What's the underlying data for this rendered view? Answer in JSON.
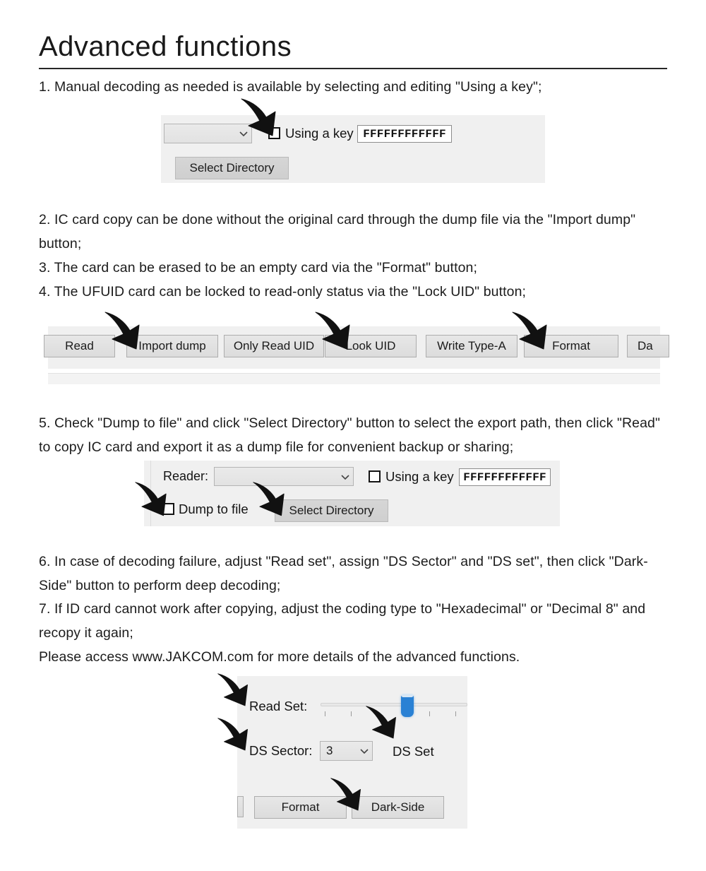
{
  "doc": {
    "title": "Advanced functions",
    "paragraphs": [
      {
        "id": "p1",
        "text": "1. Manual decoding as needed is available by selecting and editing \"Using a key\";"
      },
      {
        "id": "p2",
        "text": "2. IC card copy can be done without the original card through the dump file via the \"Import dump\" button;"
      },
      {
        "id": "p3",
        "text": "3. The card can be erased to be an empty card via the \"Format\" button;"
      },
      {
        "id": "p4",
        "text": "4. The UFUID card can be locked to read-only status via the \"Lock UID\" button;"
      },
      {
        "id": "p5",
        "text": "5. Check \"Dump to file\" and click \"Select Directory\" button to select the export path, then click \"Read\" to copy IC card and export it as a dump file for convenient backup or sharing;"
      },
      {
        "id": "p6",
        "text": "6. In case of decoding failure, adjust \"Read set\", assign \"DS Sector\" and \"DS set\", then click \"Dark-Side\" button to perform deep decoding;"
      },
      {
        "id": "p7",
        "text": "7. If ID card cannot work after copying, adjust the coding type to \"Hexadecimal\" or \"Decimal 8\" and recopy it again;"
      },
      {
        "id": "p8",
        "text": "Please access www.JAKCOM.com for more details of the advanced functions."
      }
    ]
  },
  "panel1": {
    "reader_combo_value": "",
    "using_key_label": "Using a key",
    "key_value": "FFFFFFFFFFFF",
    "select_directory_label": "Select Directory"
  },
  "panel_buttons": {
    "items": [
      {
        "label": "Read"
      },
      {
        "label": "Import dump"
      },
      {
        "label": "Only Read UID"
      },
      {
        "label": "Look UID"
      },
      {
        "label": "Write Type-A"
      },
      {
        "label": "Format"
      },
      {
        "label": "Da"
      }
    ]
  },
  "panel5": {
    "reader_label": "Reader:",
    "reader_combo_value": "",
    "using_key_label": "Using a key",
    "key_value": "FFFFFFFFFFFF",
    "dump_to_file_label": "Dump to file",
    "select_directory_label": "Select Directory"
  },
  "panel6": {
    "read_set_label": "Read Set:",
    "ds_sector_label": "DS Sector:",
    "ds_sector_value": "3",
    "ds_set_label": "DS Set",
    "format_label": "Format",
    "dark_side_label": "Dark-Side",
    "read_set_slider_percent": 60
  },
  "colors": {
    "panel_bg": "#f0f0f0",
    "button_face": "#e2e2e2",
    "slider_thumb": "#2a81d4",
    "text": "#1c1c1c",
    "rule": "#262626"
  }
}
